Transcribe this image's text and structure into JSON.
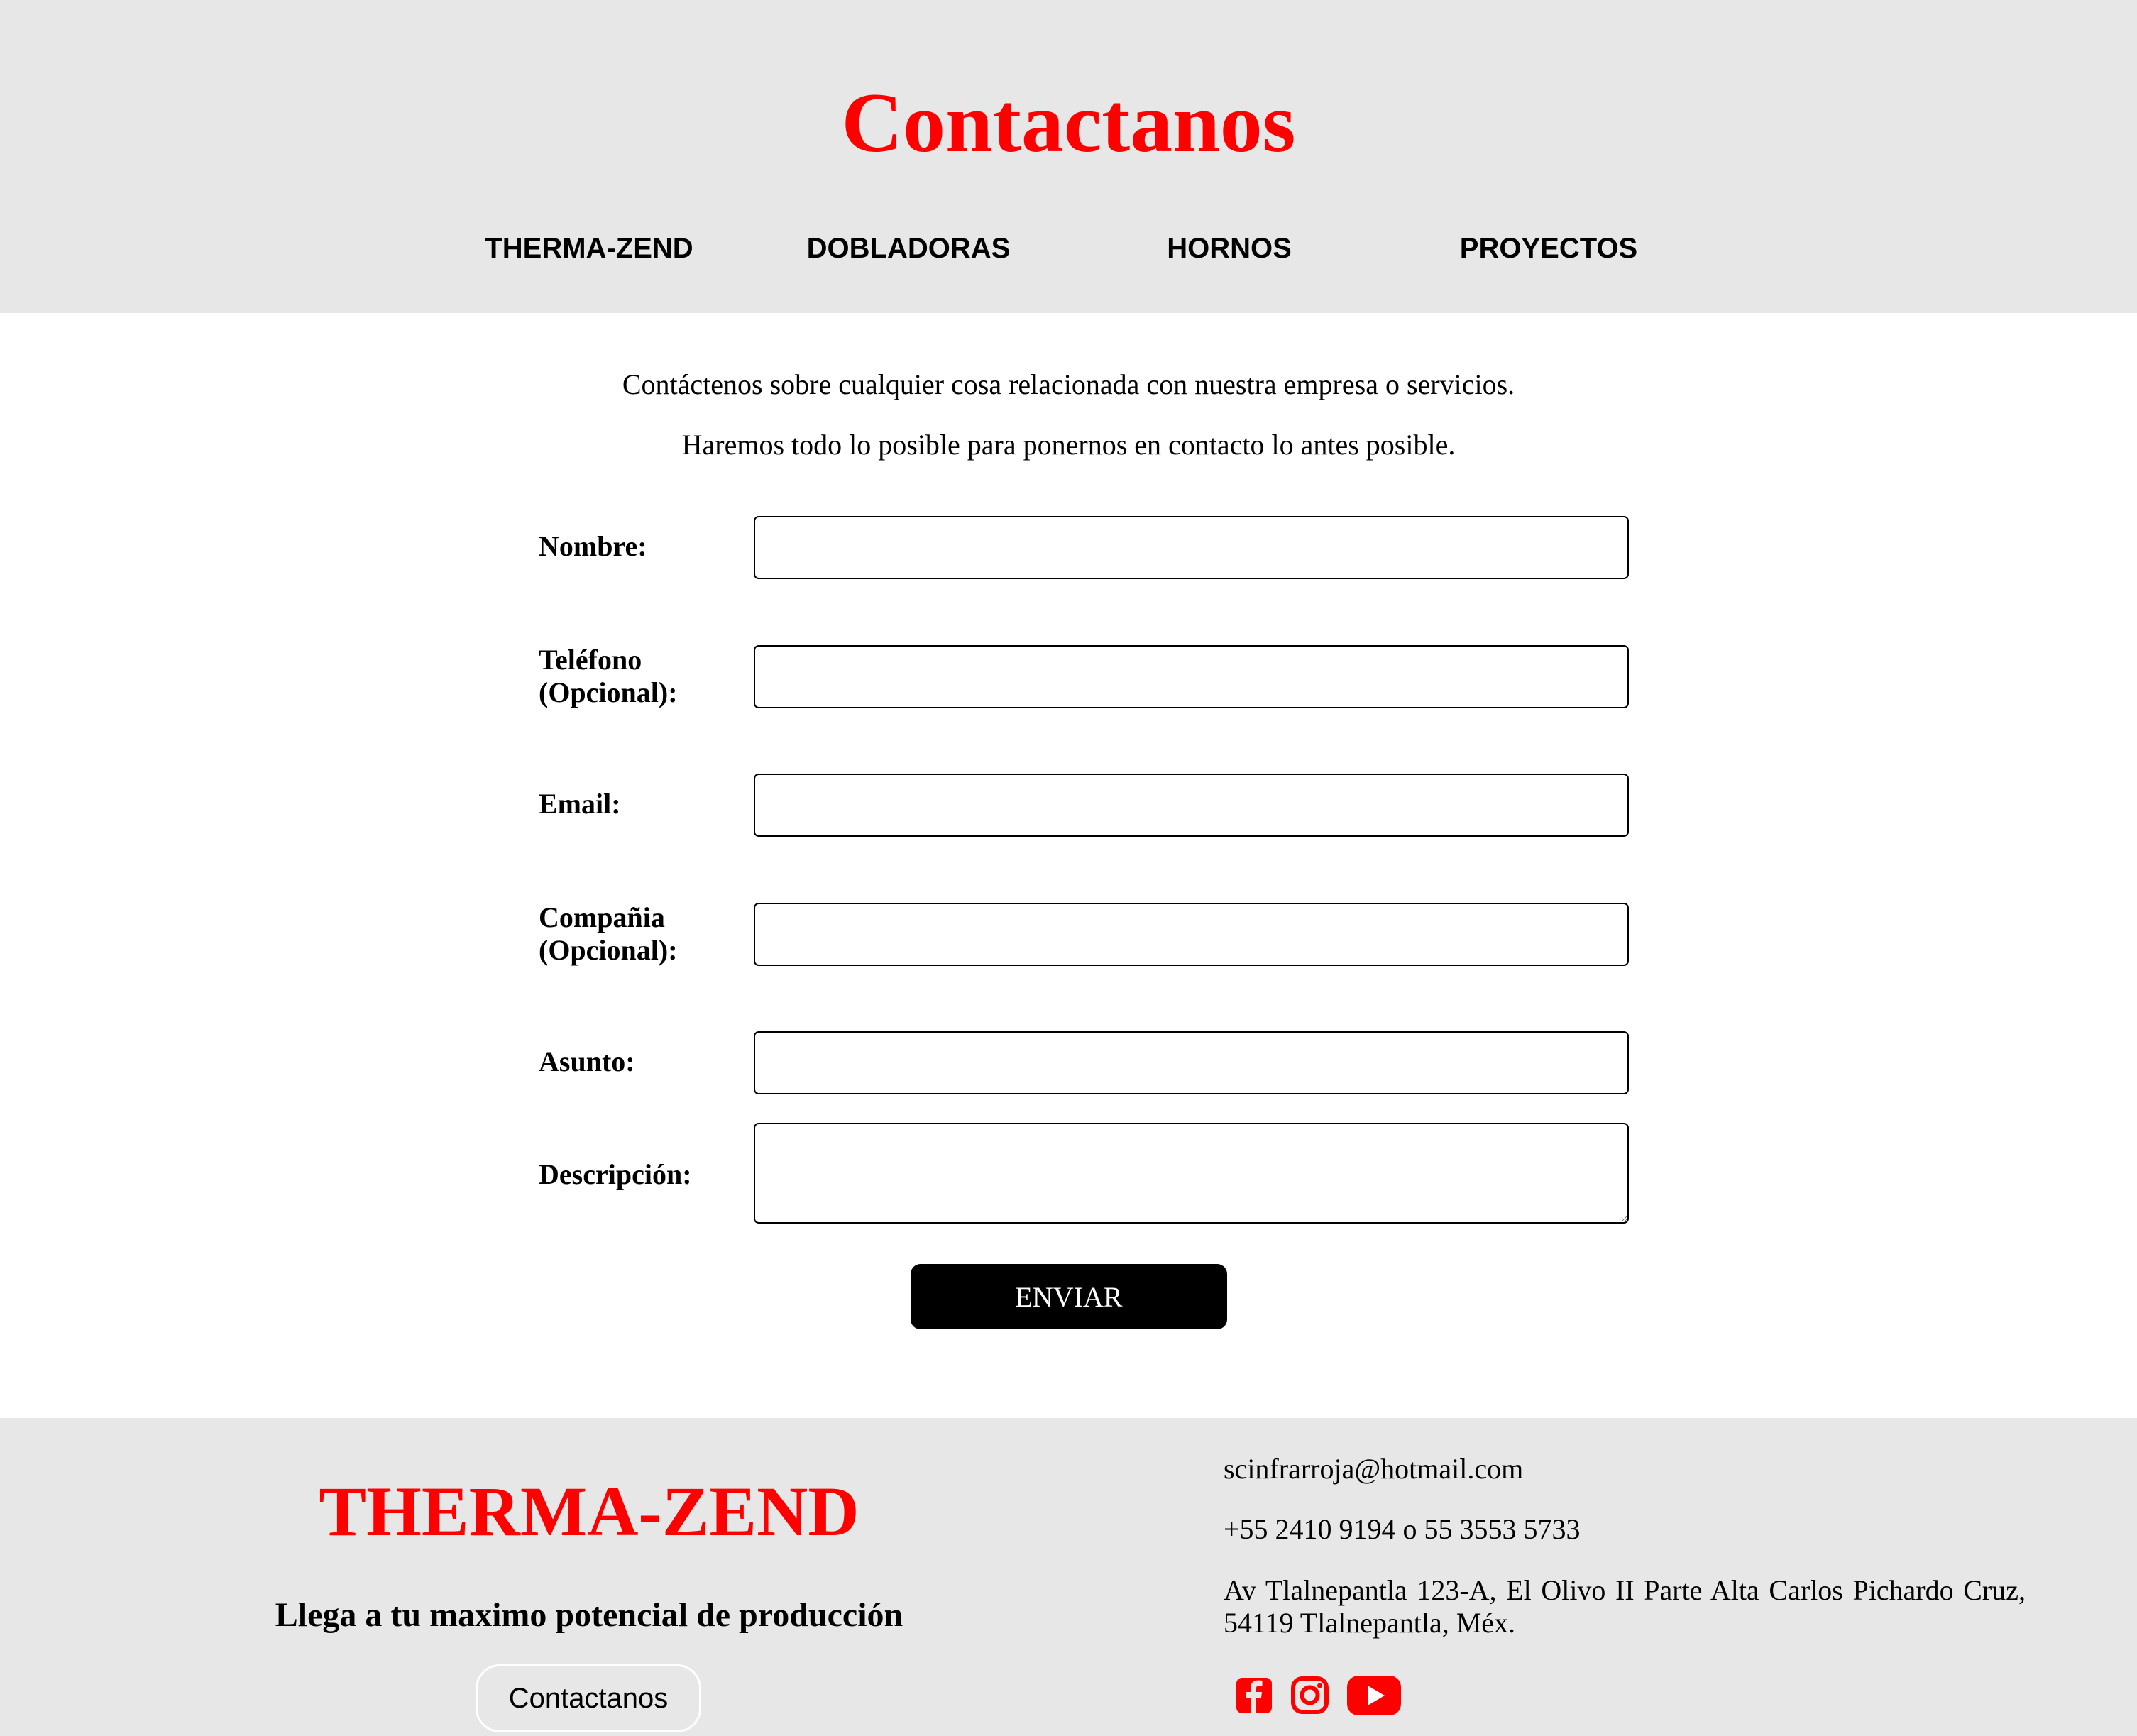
{
  "header": {
    "title": "Contactanos",
    "nav": [
      "THERMA-ZEND",
      "DOBLADORAS",
      "HORNOS",
      "PROYECTOS"
    ]
  },
  "intro": {
    "line1": "Contáctenos sobre cualquier cosa relacionada con nuestra empresa o servicios.",
    "line2": "Haremos todo lo posible para ponernos en contacto lo antes posible."
  },
  "form": {
    "nombre_label": "Nombre:",
    "telefono_label_1": "Teléfono",
    "telefono_label_2": "(Opcional):",
    "email_label": "Email:",
    "compania_label_1": "Compañia",
    "compania_label_2": "(Opcional):",
    "asunto_label": "Asunto:",
    "descripcion_label": "Descripción:",
    "nombre_value": "",
    "telefono_value": "",
    "email_value": "",
    "compania_value": "",
    "asunto_value": "",
    "descripcion_value": "",
    "submit_label": "ENVIAR"
  },
  "footer": {
    "brand": "THERMA-ZEND",
    "tagline": "Llega a tu maximo potencial de producción",
    "contact_button": "Contactanos",
    "email": "scinfrarroja@hotmail.com",
    "phone": "+55 2410 9194 o 55 3553 5733",
    "address": "Av Tlalnepantla 123-A, El Olivo II Parte Alta Carlos Pichardo Cruz, 54119 Tlalnepantla, Méx.",
    "social_icons": [
      "facebook-icon",
      "instagram-icon",
      "youtube-icon"
    ]
  },
  "colors": {
    "accent": "#ff0000",
    "band_background": "#e7e7e7",
    "button": "#000000"
  }
}
